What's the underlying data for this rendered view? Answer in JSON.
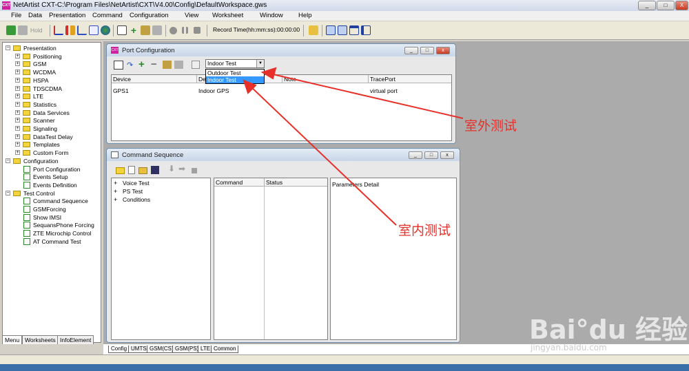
{
  "window": {
    "title": "NetArtist CXT-C:\\Program Files\\NetArtist\\CXT\\V4.00\\Config\\DefaultWorkspace.gws",
    "icon_text": "CXT",
    "controls": [
      "_",
      "□",
      "X"
    ]
  },
  "menubar": [
    "File",
    "Data",
    "Presentation",
    "Command",
    "Configuration",
    "View",
    "Worksheet",
    "Window",
    "Help"
  ],
  "toolbar": {
    "hold_label": "Hold",
    "record_time": "Record Time(hh:mm:ss):00:00:00"
  },
  "tree": [
    {
      "label": "Presentation",
      "kind": "folder",
      "level": 0,
      "expander": "−"
    },
    {
      "label": "Positioning",
      "kind": "folder",
      "level": 1,
      "expander": "+"
    },
    {
      "label": "GSM",
      "kind": "folder",
      "level": 1,
      "expander": "+"
    },
    {
      "label": "WCDMA",
      "kind": "folder",
      "level": 1,
      "expander": "+"
    },
    {
      "label": "HSPA",
      "kind": "folder",
      "level": 1,
      "expander": "+"
    },
    {
      "label": "TDSCDMA",
      "kind": "folder",
      "level": 1,
      "expander": "+"
    },
    {
      "label": "LTE",
      "kind": "folder",
      "level": 1,
      "expander": "+"
    },
    {
      "label": "Statistics",
      "kind": "folder",
      "level": 1,
      "expander": "+"
    },
    {
      "label": "Data Services",
      "kind": "folder",
      "level": 1,
      "expander": "+"
    },
    {
      "label": "Scanner",
      "kind": "folder",
      "level": 1,
      "expander": "+"
    },
    {
      "label": "Signaling",
      "kind": "folder",
      "level": 1,
      "expander": "+"
    },
    {
      "label": "DataTest Delay",
      "kind": "folder",
      "level": 1,
      "expander": "+"
    },
    {
      "label": "Templates",
      "kind": "folder",
      "level": 1,
      "expander": "+"
    },
    {
      "label": "Custom Form",
      "kind": "folder",
      "level": 1,
      "expander": "+"
    },
    {
      "label": "Configuration",
      "kind": "folder",
      "level": 0,
      "expander": "−"
    },
    {
      "label": "Port Configuration",
      "kind": "doc",
      "level": 1
    },
    {
      "label": "Events Setup",
      "kind": "doc",
      "level": 1
    },
    {
      "label": "Events Definition",
      "kind": "doc",
      "level": 1
    },
    {
      "label": "Test Control",
      "kind": "folder",
      "level": 0,
      "expander": "−"
    },
    {
      "label": "Command Sequence",
      "kind": "doc",
      "level": 1
    },
    {
      "label": "GSMForcing",
      "kind": "doc",
      "level": 1
    },
    {
      "label": "Show IMSI",
      "kind": "doc",
      "level": 1
    },
    {
      "label": "SequansPhone Forcing",
      "kind": "doc",
      "level": 1
    },
    {
      "label": "ZTE Microchip Control",
      "kind": "doc",
      "level": 1
    },
    {
      "label": "AT Command Test",
      "kind": "doc",
      "level": 1
    }
  ],
  "left_tabs": [
    "Menu",
    "Worksheets",
    "InfoElement"
  ],
  "port_config": {
    "title": "Port Configuration",
    "icon_text": "CXT",
    "dropdown_value": "Indoor Test",
    "dropdown_options": [
      "Outdoor Test",
      "Indoor Test"
    ],
    "columns": [
      "Device",
      "De",
      "Note",
      "TracePort"
    ],
    "rows": [
      {
        "device": "GPS1",
        "desc": "Indoor GPS",
        "note": "",
        "trace": "virtual port"
      }
    ]
  },
  "command_seq": {
    "title": "Command Sequence",
    "tree": [
      "Voice Test",
      "PS Test",
      "Conditions"
    ],
    "columns": [
      "Command",
      "Status"
    ],
    "params_label": "Parameters Detail"
  },
  "sheet_tabs": [
    "Config",
    "UMTS",
    "GSM(CS)",
    "GSM(PS)",
    "LTE",
    "Common"
  ],
  "annotations": {
    "outdoor": "室外测试",
    "indoor": "室内测试"
  },
  "watermark": {
    "main": "Bai°du 经验",
    "sub": "jingyan.baidu.com"
  }
}
